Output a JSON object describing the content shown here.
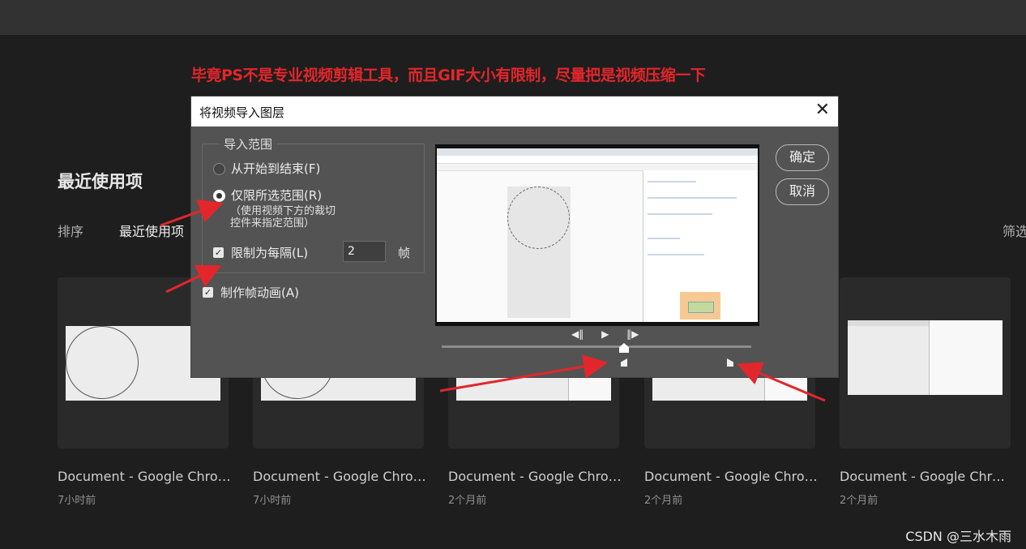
{
  "annotation": "毕竟PS不是专业视频剪辑工具，而且GIF大小有限制，尽量把是视频压缩一下",
  "home": {
    "section_title": "最近使用项",
    "sort_label": "排序",
    "sort_value": "最近使用项",
    "filter_label": "筛选"
  },
  "cards": [
    {
      "name": "Document - Google Chrom...",
      "time": "7小时前"
    },
    {
      "name": "Document - Google Chrom...",
      "time": "7小时前"
    },
    {
      "name": "Document - Google Chrom...",
      "time": "2个月前"
    },
    {
      "name": "Document - Google Chrom...",
      "time": "2个月前"
    },
    {
      "name": "Document - Google Chrom...",
      "time": "2个月前"
    }
  ],
  "dialog": {
    "title": "将视频导入图层",
    "close_glyph": "✕",
    "group_label": "导入范围",
    "option_all": "从开始到结束(F)",
    "option_range": "仅限所选范围(R)",
    "option_range_hint_1": "（使用视频下方的裁切",
    "option_range_hint_2": "控件来指定范围）",
    "limit_label": "限制为每隔(L)",
    "limit_value": "2",
    "limit_unit": "帧",
    "make_animation_label": "制作帧动画(A)",
    "ok_label": "确定",
    "cancel_label": "取消",
    "controls": {
      "prev": "◀‖",
      "play": "▶",
      "next": "‖▶"
    }
  },
  "watermark": "CSDN @三水木雨",
  "colors": {
    "accent_red": "#e3262b",
    "dialog_bg": "#535353"
  }
}
